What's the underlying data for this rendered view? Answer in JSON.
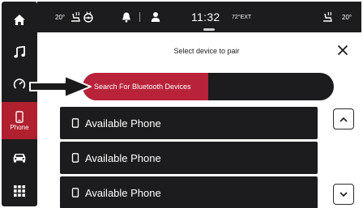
{
  "status_bar": {
    "left_temp": "20°",
    "clock": "11:32",
    "exterior_temp": "72°EXT",
    "right_temp": "20°"
  },
  "rail": {
    "items": [
      {
        "name": "home",
        "icon": "home-icon"
      },
      {
        "name": "media",
        "icon": "music-note-icon"
      },
      {
        "name": "controls",
        "icon": "gauge-icon"
      },
      {
        "name": "phone",
        "icon": "phone-icon",
        "label": "Phone",
        "active": true
      },
      {
        "name": "vehicle",
        "icon": "car-icon"
      },
      {
        "name": "apps",
        "icon": "grid-icon"
      }
    ]
  },
  "pairing": {
    "title": "Select device to pair",
    "search_label": "Search For Bluetooth Devices",
    "search_progress": 0.5
  },
  "devices": [
    {
      "label": "Available Phone"
    },
    {
      "label": "Available Phone"
    },
    {
      "label": "Available Phone"
    }
  ],
  "colors": {
    "accent": "#b8233a",
    "bar": "#1c1c1e",
    "background": "#ffffff"
  }
}
